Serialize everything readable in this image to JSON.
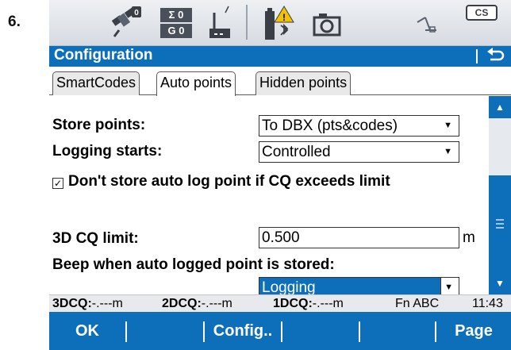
{
  "step_number": "6.",
  "status_bar": {
    "icons": [
      "satellite-icon",
      "sigma-counter-icon",
      "radio-antenna-icon",
      "battery-bluetooth-warning-icon",
      "camera-icon",
      "line-tool-icon",
      "cs-badge-icon"
    ],
    "sigma_top": "Σ 0",
    "sigma_bottom": "G 0",
    "sat_count": "0",
    "cs_label": "CS"
  },
  "title_bar": {
    "title": "Configuration",
    "back_icon": "back-arrow-icon"
  },
  "tabs": [
    {
      "label": "SmartCodes",
      "active": false
    },
    {
      "label": "Auto points",
      "active": true
    },
    {
      "label": "Hidden points",
      "active": false
    }
  ],
  "form": {
    "store_points": {
      "label": "Store points:",
      "value": "To DBX (pts&codes)"
    },
    "logging_starts": {
      "label": "Logging starts:",
      "value": "Controlled"
    },
    "dont_store": {
      "label": "Don't store auto log point if CQ exceeds limit",
      "checked": true,
      "check_glyph": "✓"
    },
    "cq_limit": {
      "label": "3D CQ limit:",
      "value": "0.500",
      "unit": "m"
    },
    "beep": {
      "label": "Beep when auto logged point is stored:",
      "value": "Logging"
    }
  },
  "info_bar": {
    "d3_label": "3DCQ:",
    "d3_value": "-.---m",
    "d2_label": "2DCQ:",
    "d2_value": "-.---m",
    "d1_label": "1DCQ:",
    "d1_value": "-.---m",
    "mode": "Fn ABC",
    "time": "11:43"
  },
  "softkeys": {
    "ok": "OK",
    "config": "Config..",
    "page": "Page"
  }
}
